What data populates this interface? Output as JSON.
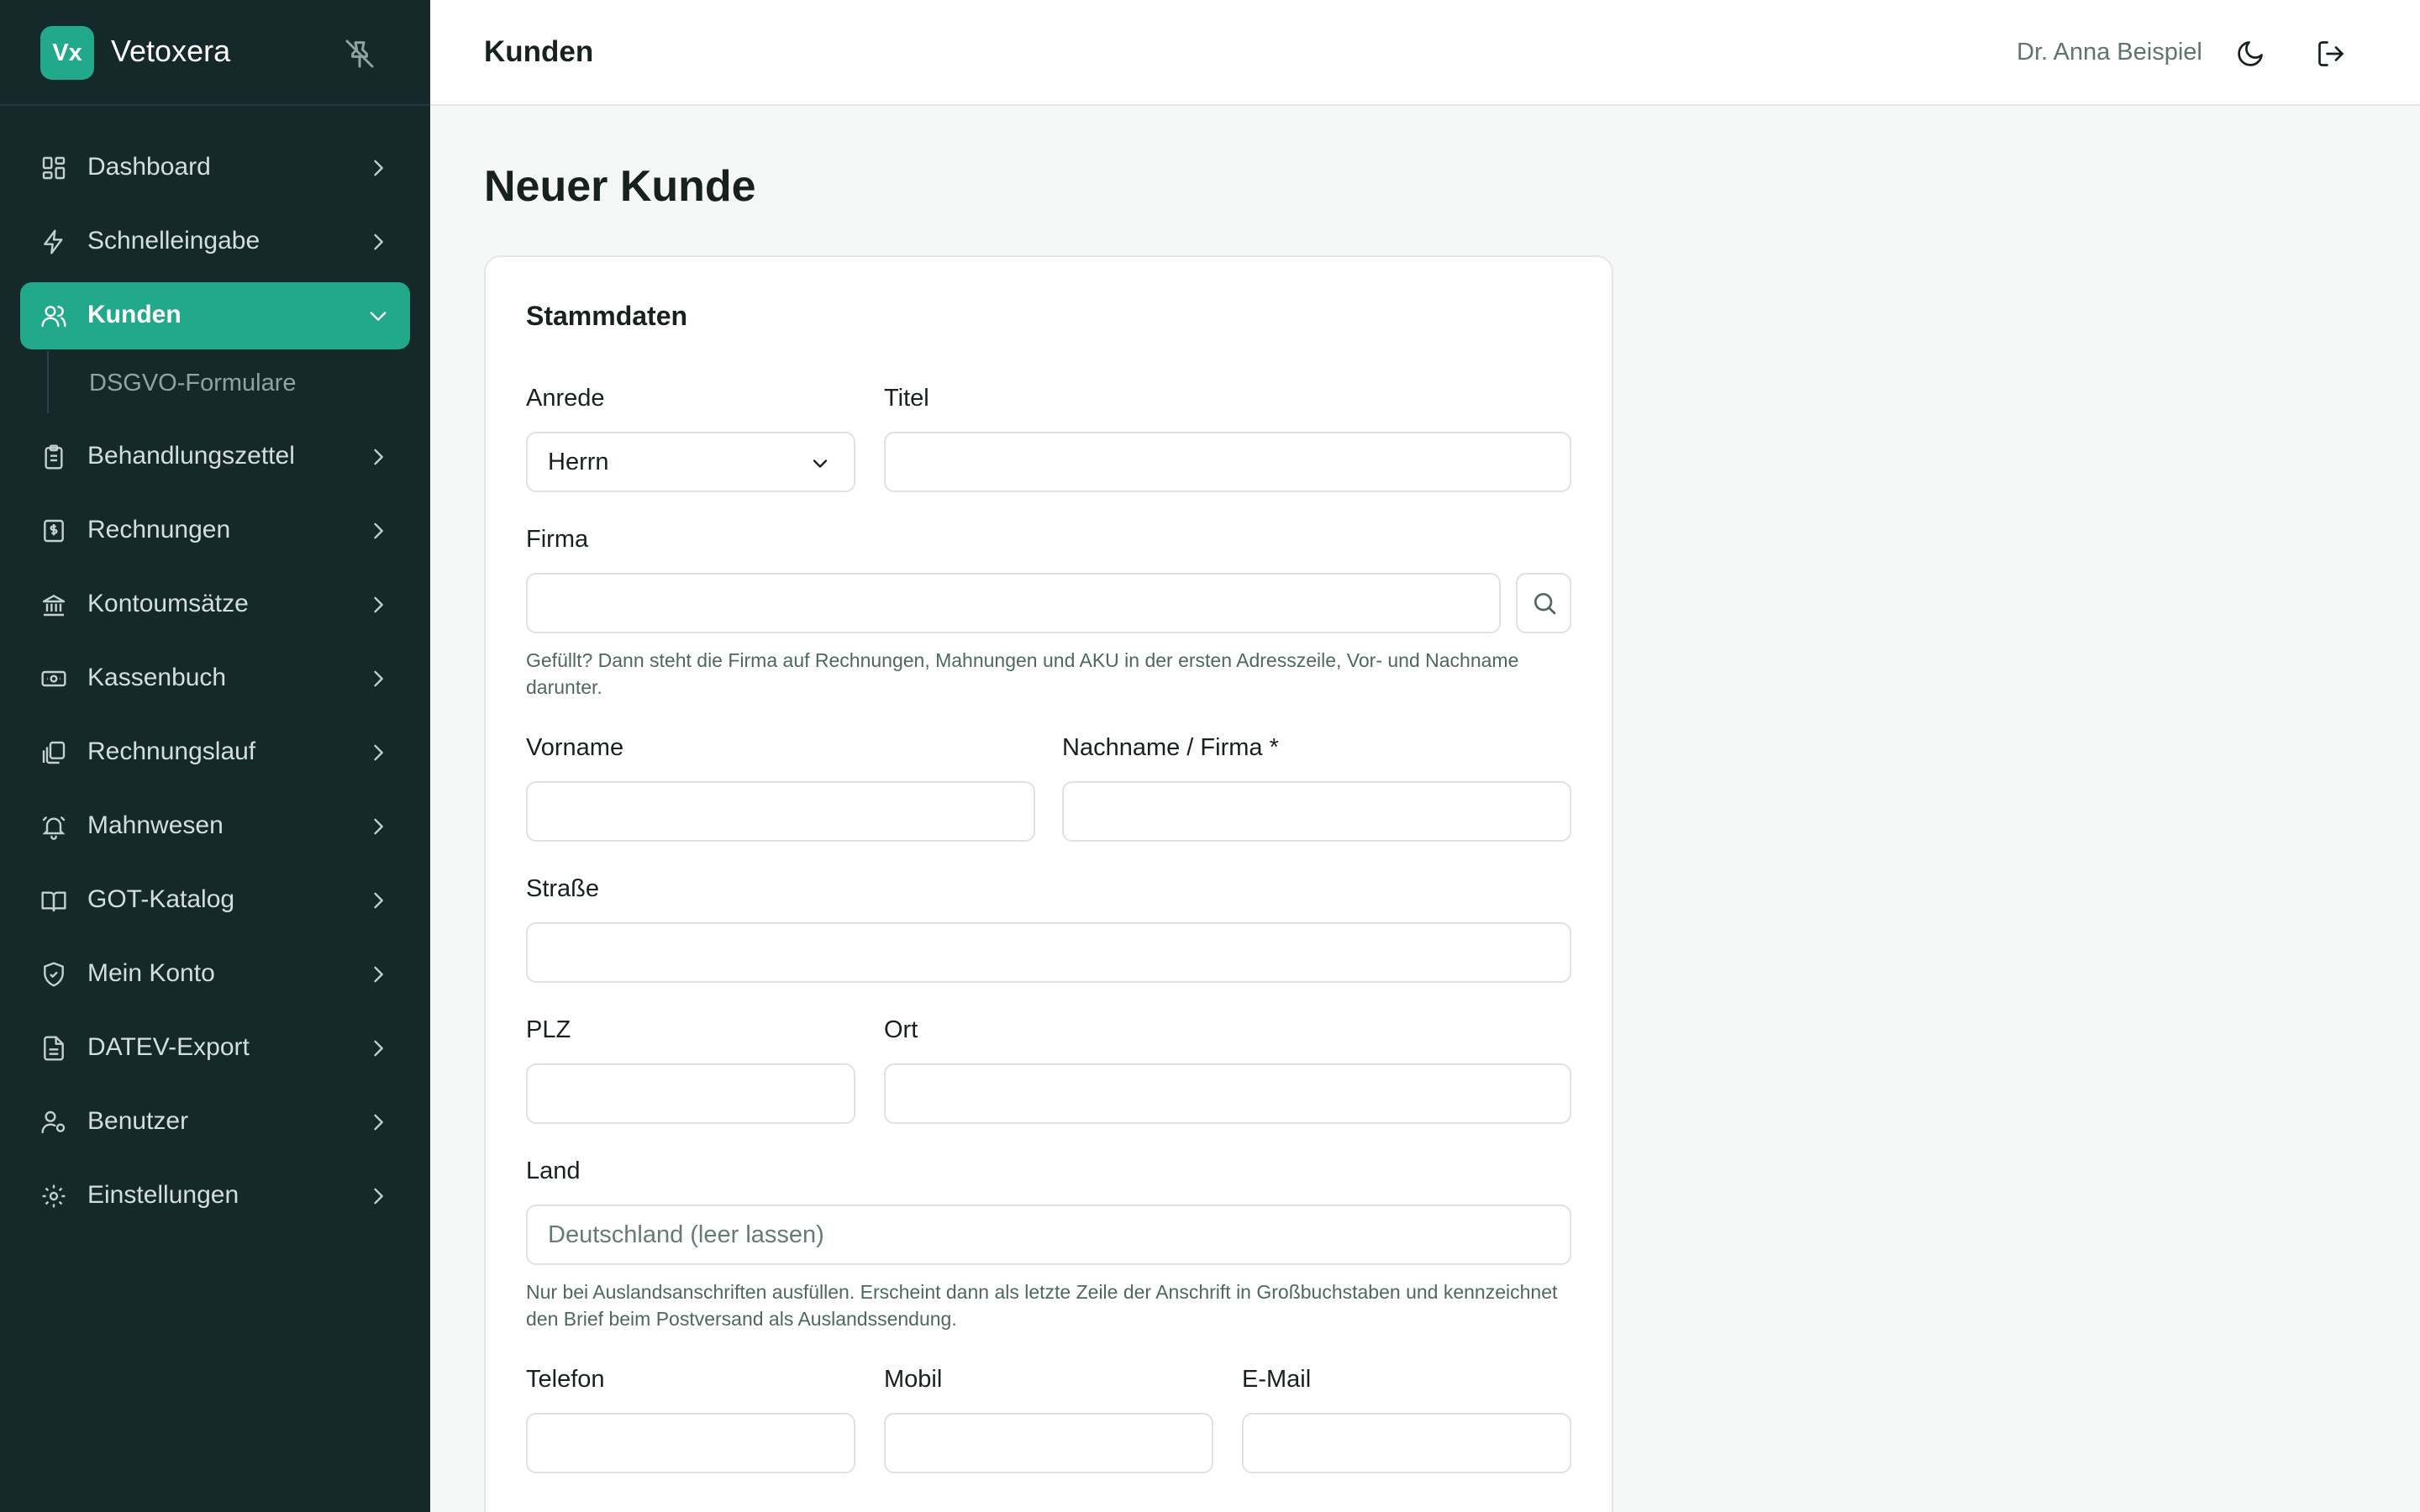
{
  "brand": {
    "logo": "Vx",
    "name": "Vetoxera"
  },
  "sidebar": {
    "items": [
      {
        "label": "Dashboard",
        "icon": "dashboard-icon"
      },
      {
        "label": "Schnelleingabe",
        "icon": "bolt-icon"
      },
      {
        "label": "Kunden",
        "icon": "users-icon",
        "active": true
      },
      {
        "label": "Behandlungszettel",
        "icon": "clipboard-icon"
      },
      {
        "label": "Rechnungen",
        "icon": "invoice-icon"
      },
      {
        "label": "Kontoumsätze",
        "icon": "bank-icon"
      },
      {
        "label": "Kassenbuch",
        "icon": "cash-icon"
      },
      {
        "label": "Rechnungslauf",
        "icon": "stack-icon"
      },
      {
        "label": "Mahnwesen",
        "icon": "bell-icon"
      },
      {
        "label": "GOT-Katalog",
        "icon": "book-icon"
      },
      {
        "label": "Mein Konto",
        "icon": "shield-icon"
      },
      {
        "label": "DATEV-Export",
        "icon": "file-icon"
      },
      {
        "label": "Benutzer",
        "icon": "user-gear-icon"
      },
      {
        "label": "Einstellungen",
        "icon": "gear-icon"
      }
    ],
    "sub_items": [
      "DSGVO-Formulare"
    ]
  },
  "header": {
    "title": "Kunden",
    "user": "Dr. Anna Beispiel"
  },
  "page": {
    "title": "Neuer Kunde"
  },
  "form": {
    "section_title": "Stammdaten",
    "anrede": {
      "label": "Anrede",
      "value": "Herrn"
    },
    "titel": {
      "label": "Titel",
      "value": ""
    },
    "firma": {
      "label": "Firma",
      "value": "",
      "hint": "Gefüllt? Dann steht die Firma auf Rechnungen, Mahnungen und AKU in der ersten Adresszeile, Vor- und Nachname darunter."
    },
    "vorname": {
      "label": "Vorname",
      "value": ""
    },
    "nachname": {
      "label": "Nachname / Firma *",
      "value": ""
    },
    "strasse": {
      "label": "Straße",
      "value": ""
    },
    "plz": {
      "label": "PLZ",
      "value": ""
    },
    "ort": {
      "label": "Ort",
      "value": ""
    },
    "land": {
      "label": "Land",
      "value": "",
      "placeholder": "Deutschland (leer lassen)",
      "hint": "Nur bei Auslandsanschriften ausfüllen. Erscheint dann als letzte Zeile der Anschrift in Großbuchstaben und kennzeichnet den Brief beim Postversand als Auslandssendung."
    },
    "telefon": {
      "label": "Telefon",
      "value": ""
    },
    "mobil": {
      "label": "Mobil",
      "value": ""
    },
    "email": {
      "label": "E-Mail",
      "value": ""
    }
  },
  "colors": {
    "sidebar_bg": "#15282a",
    "accent": "#22a88a",
    "page_bg": "#f6f8f7"
  }
}
